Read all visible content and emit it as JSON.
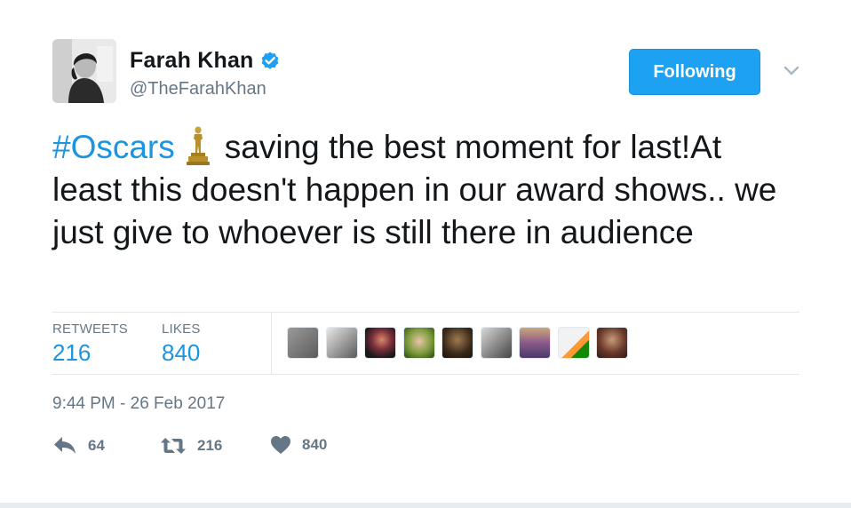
{
  "user": {
    "display_name": "Farah Khan",
    "handle": "@TheFarahKhan",
    "verified": true
  },
  "follow_button": {
    "label": "Following"
  },
  "tweet": {
    "hashtag": "#Oscars",
    "emoji": "oscar-trophy-icon",
    "text_after": "saving the best moment for last!At least this doesn't happen in our award shows.. we just give to whoever is still there in audience"
  },
  "stats": {
    "retweets_label": "RETWEETS",
    "retweets_value": "216",
    "likes_label": "LIKES",
    "likes_value": "840",
    "liker_avatars_count": 9
  },
  "timestamp": "9:44 PM - 26 Feb 2017",
  "actions": {
    "reply_count": "64",
    "retweet_count": "216",
    "like_count": "840"
  },
  "colors": {
    "accent": "#1da1f2",
    "link": "#1b95e0",
    "muted": "#657786",
    "text": "#14171a",
    "border": "#e1e8ed"
  }
}
